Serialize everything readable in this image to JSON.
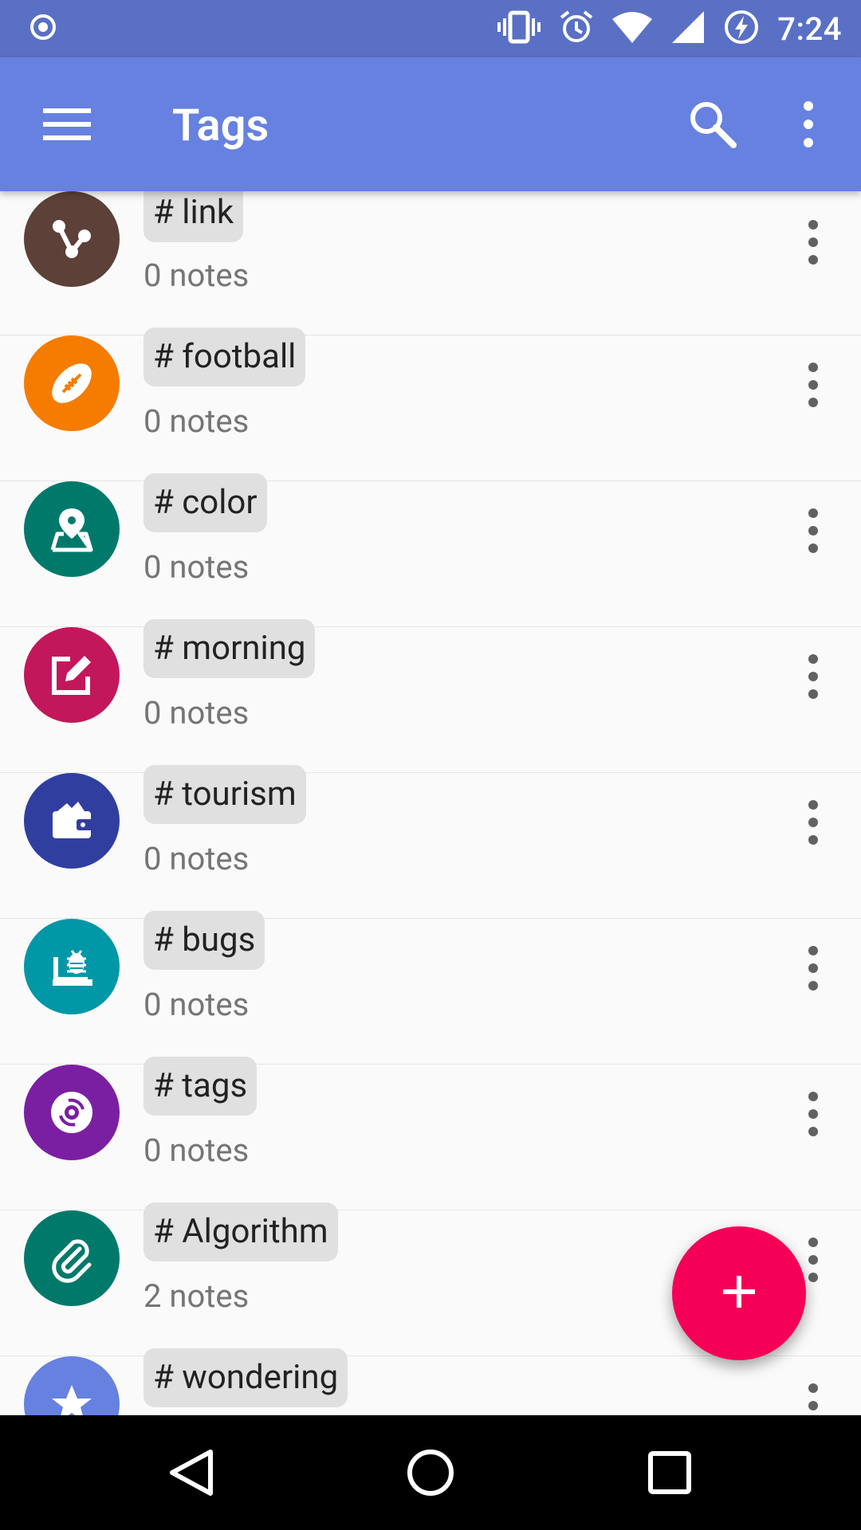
{
  "status_bar": {
    "time": "7:24",
    "icons": [
      "record-icon",
      "vibrate-icon",
      "alarm-icon",
      "wifi-icon",
      "signal-icon",
      "battery-charging-icon"
    ]
  },
  "app_bar": {
    "title": "Tags",
    "icons": [
      "menu-icon",
      "search-icon",
      "more-vert-icon"
    ]
  },
  "tags": [
    {
      "label": "# link",
      "count": "0 notes",
      "color": "#5d4037",
      "icon": "link-nodes-icon"
    },
    {
      "label": "# football",
      "count": "0 notes",
      "color": "#f57c00",
      "icon": "football-icon"
    },
    {
      "label": "# color",
      "count": "0 notes",
      "color": "#00796b",
      "icon": "map-pin-icon"
    },
    {
      "label": "# morning",
      "count": "0 notes",
      "color": "#c2185b",
      "icon": "edit-icon"
    },
    {
      "label": "# tourism",
      "count": "0 notes",
      "color": "#303f9f",
      "icon": "wallet-icon"
    },
    {
      "label": "# bugs",
      "count": "0 notes",
      "color": "#0097a7",
      "icon": "bug-report-icon"
    },
    {
      "label": "# tags",
      "count": "0 notes",
      "color": "#7b1fa2",
      "icon": "disc-icon"
    },
    {
      "label": "# Algorithm",
      "count": "2 notes",
      "color": "#00796b",
      "icon": "attachment-icon"
    },
    {
      "label": "# wondering",
      "count": "",
      "color": "#6681df",
      "icon": "star-icon"
    }
  ],
  "fab": {
    "icon": "add-icon",
    "color": "#f50057"
  },
  "nav_bar": {
    "icons": [
      "back-icon",
      "home-icon",
      "recents-icon"
    ]
  }
}
